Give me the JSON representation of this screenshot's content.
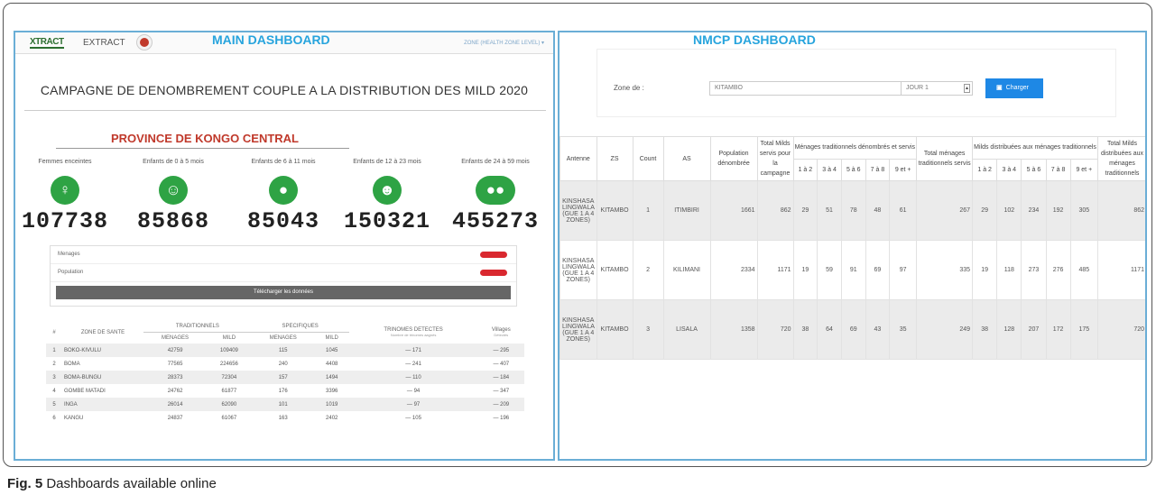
{
  "main": {
    "title": "MAIN DASHBOARD",
    "logo_text": "XTRACT",
    "brand": "EXTRACT",
    "zone_dropdown": "ZONE (HEALTH ZONE LEVEL) ▾",
    "campaign_title": "CAMPAGNE DE DENOMBREMENT COUPLE A LA DISTRIBUTION DES MILD 2020",
    "province": "PROVINCE DE KONGO CENTRAL",
    "stats": [
      {
        "label": "Femmes enceintes",
        "value": "107738",
        "icon": "pregnant-woman-icon",
        "glyph": "♀"
      },
      {
        "label": "Enfants de 0 à 5 mois",
        "value": "85868",
        "icon": "baby-face-icon",
        "glyph": "☺"
      },
      {
        "label": "Enfants de 6 à 11 mois",
        "value": "85043",
        "icon": "crawling-baby-icon",
        "glyph": "●"
      },
      {
        "label": "Enfants de 12 à 23 mois",
        "value": "150321",
        "icon": "toddler-icon",
        "glyph": "☻"
      },
      {
        "label": "Enfants de 24 à 59 mois",
        "value": "455273",
        "icon": "children-group-icon",
        "glyph": "●●"
      }
    ],
    "download": {
      "rows": [
        "Menages",
        "Population"
      ],
      "button": "Télécharger les données"
    },
    "table": {
      "group_headers": [
        "TRADITIONNELS",
        "SPECIFIQUES"
      ],
      "headers": [
        "#",
        "ZONE DE SANTE",
        "MENAGES",
        "MILD",
        "MENAGES",
        "MILD",
        "TRINOMES DETECTES",
        "Villages"
      ],
      "subheaders": [
        "Nombre de trinomes aagnés",
        "Détectés"
      ],
      "rows": [
        [
          "1",
          "BOKO-KIVULU",
          "42759",
          "109409",
          "115",
          "1045",
          "— 171",
          "— 295"
        ],
        [
          "2",
          "BOMA",
          "77565",
          "224656",
          "240",
          "4408",
          "— 241",
          "— 407"
        ],
        [
          "3",
          "BOMA-BUNGU",
          "28373",
          "72304",
          "157",
          "1494",
          "— 110",
          "— 184"
        ],
        [
          "4",
          "GOMBE MATADI",
          "24762",
          "61877",
          "176",
          "3396",
          "— 94",
          "— 347"
        ],
        [
          "5",
          "INGA",
          "26014",
          "62090",
          "101",
          "1019",
          "— 97",
          "— 209"
        ],
        [
          "6",
          "KANGU",
          "24837",
          "61067",
          "163",
          "2402",
          "— 105",
          "— 196"
        ]
      ]
    }
  },
  "nmcp": {
    "title": "NMCP DASHBOARD",
    "zone_label": "Zone de :",
    "zone_value": "KITAMBO",
    "day_value": "JOUR 1",
    "load_button": "Charger",
    "headers": {
      "antenne": "Antenne",
      "zs": "ZS",
      "count": "Count",
      "as": "AS",
      "population": "Population dénombrée",
      "total_mild": "Total Milds servis pour la campagne",
      "menages_group": "Ménages traditionnels dénombrés et servis",
      "total_menages": "Total ménages traditionnels servis",
      "mild_group": "Milds distribuées aux ménages traditionnels",
      "total_distrib": "Total Milds distribuées aux ménages traditionnels",
      "sub": [
        "1 à 2",
        "3 à 4",
        "5 à 6",
        "7 à 8",
        "9 et +"
      ]
    },
    "rows": [
      {
        "antenne": "KINSHASA LINGWALA (GUE 1 A 4 ZONES)",
        "zs": "KITAMBO",
        "count": "1",
        "as": "ITIMBIRI",
        "population": "1661",
        "total_mild": "862",
        "menages": [
          "29",
          "51",
          "78",
          "48",
          "61"
        ],
        "total_menages": "267",
        "milds": [
          "29",
          "102",
          "234",
          "192",
          "305"
        ],
        "total_distrib": "862"
      },
      {
        "antenne": "KINSHASA LINGWALA (GUE 1 A 4 ZONES)",
        "zs": "KITAMBO",
        "count": "2",
        "as": "KILIMANI",
        "population": "2334",
        "total_mild": "1171",
        "menages": [
          "19",
          "59",
          "91",
          "69",
          "97"
        ],
        "total_menages": "335",
        "milds": [
          "19",
          "118",
          "273",
          "276",
          "485"
        ],
        "total_distrib": "1171"
      },
      {
        "antenne": "KINSHASA LINGWALA (GUE 1 A 4 ZONES)",
        "zs": "KITAMBO",
        "count": "3",
        "as": "LISALA",
        "population": "1358",
        "total_mild": "720",
        "menages": [
          "38",
          "64",
          "69",
          "43",
          "35"
        ],
        "total_menages": "249",
        "milds": [
          "38",
          "128",
          "207",
          "172",
          "175"
        ],
        "total_distrib": "720"
      }
    ]
  },
  "caption": {
    "label": "Fig. 5",
    "text": " Dashboards available online"
  }
}
